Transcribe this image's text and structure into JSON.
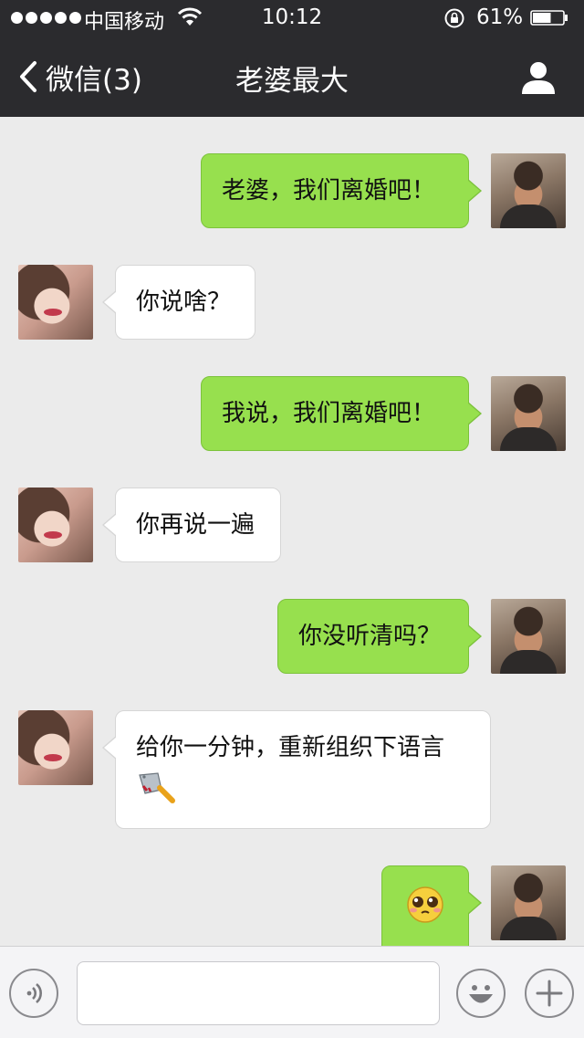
{
  "status_bar": {
    "carrier": "中国移动",
    "time": "10:12",
    "battery_percent": "61%",
    "battery_level": 0.61,
    "signal_dots": 5
  },
  "nav": {
    "back_label": "微信(3)",
    "title": "老婆最大",
    "icons": {
      "back": "chevron-left-icon",
      "profile": "person-icon"
    }
  },
  "messages": [
    {
      "side": "me",
      "text": "老婆，我们离婚吧！"
    },
    {
      "side": "her",
      "text": "你说啥？"
    },
    {
      "side": "me",
      "text": "我说，我们离婚吧！"
    },
    {
      "side": "her",
      "text": "你再说一遍"
    },
    {
      "side": "me",
      "text": "你没听清吗？"
    },
    {
      "side": "her",
      "text": "给你一分钟，重新组织下语言",
      "emoji": "cleaver-knife-icon"
    },
    {
      "side": "me",
      "text": "",
      "emoji": "pleading-face-icon"
    }
  ],
  "input_bar": {
    "text_value": "",
    "icons": {
      "voice": "voice-icon",
      "emoji": "smiley-icon",
      "more": "plus-icon"
    }
  },
  "colors": {
    "nav_background": "#2b2b2e",
    "chat_background": "#ebebeb",
    "my_bubble": "#97e04e",
    "her_bubble": "#ffffff"
  }
}
